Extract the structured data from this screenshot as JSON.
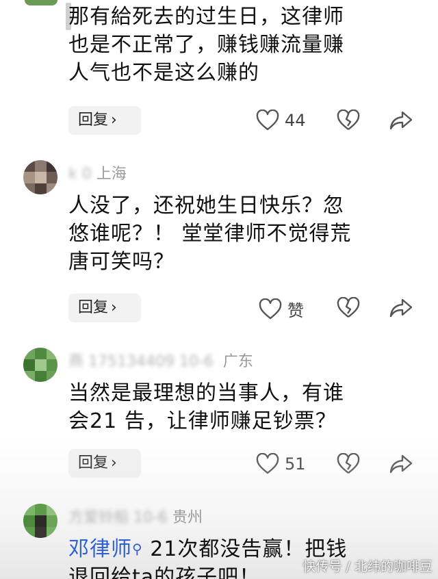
{
  "comments": [
    {
      "meta": {
        "prefix": "",
        "blurred": "",
        "location": ""
      },
      "lines": [
        "那有給死去的过生日，这律师",
        "也是不正常了，赚钱赚流量赚",
        "人气也不是这么赚的"
      ],
      "reply_label": "回复",
      "like_count": "44"
    },
    {
      "meta": {
        "prefix": "",
        "blurred": "k 0 ",
        "location": "上海"
      },
      "lines": [
        "人没了，还祝她生日快乐？忽",
        "悠谁呢？！ 堂堂律师不觉得荒",
        "唐可笑吗？"
      ],
      "reply_label": "回复",
      "like_count": "赞"
    },
    {
      "meta": {
        "prefix": "",
        "blurred": "燕 175134409 10-6",
        "location": "广东"
      },
      "lines": [
        "当然是最理想的当事人，有谁",
        "会21 告，让律师赚足钞票？"
      ],
      "reply_label": "回复",
      "like_count": "51"
    },
    {
      "meta": {
        "prefix": "",
        "blurred": "方爱铃船 10-6",
        "location": "贵州"
      },
      "mention": "邓律师",
      "lines": [
        "21次都没告赢！把钱",
        "退回给ta的孩子吧！"
      ]
    }
  ],
  "watermark": "快传号 / 北纬的咖啡豆",
  "colors": {
    "mention": "#2f5fd6",
    "meta": "#9a9a9a",
    "button_bg": "#f2f2f2"
  },
  "icons": {
    "like": "heart-outline-icon",
    "dislike": "broken-heart-icon",
    "share": "share-arrow-icon",
    "mention_search": "search-icon"
  }
}
